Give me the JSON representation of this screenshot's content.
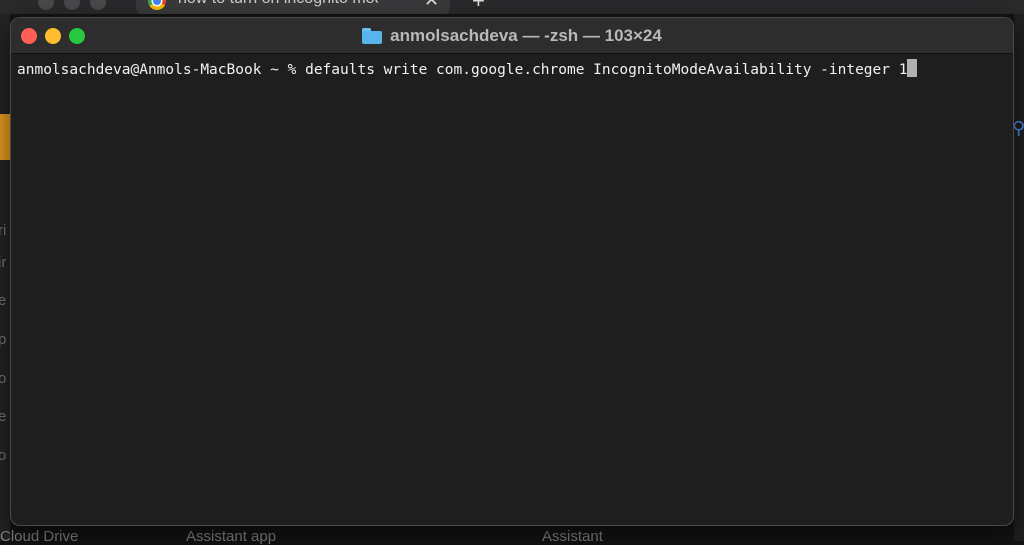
{
  "background": {
    "chrome_tab_title": "how to turn on incognito mode",
    "chrome_tab_close": "✕",
    "chrome_new_tab": "+",
    "left_letters": [
      "ri",
      "ir",
      "e",
      "p",
      "o",
      "e",
      "o"
    ],
    "bottom_texts": [
      "Cloud Drive",
      "Assistant app",
      "Assistant"
    ]
  },
  "window": {
    "title": "anmolsachdeva — -zsh — 103×24",
    "folder_icon": "folder-icon"
  },
  "terminal": {
    "prompt": "anmolsachdeva@Anmols-MacBook ~ % ",
    "command": "defaults write com.google.chrome IncognitoModeAvailability -integer 1"
  },
  "colors": {
    "close": "#ff5f57",
    "minimize": "#febc2e",
    "maximize": "#28c840",
    "terminal_bg": "#1e1e1e"
  }
}
